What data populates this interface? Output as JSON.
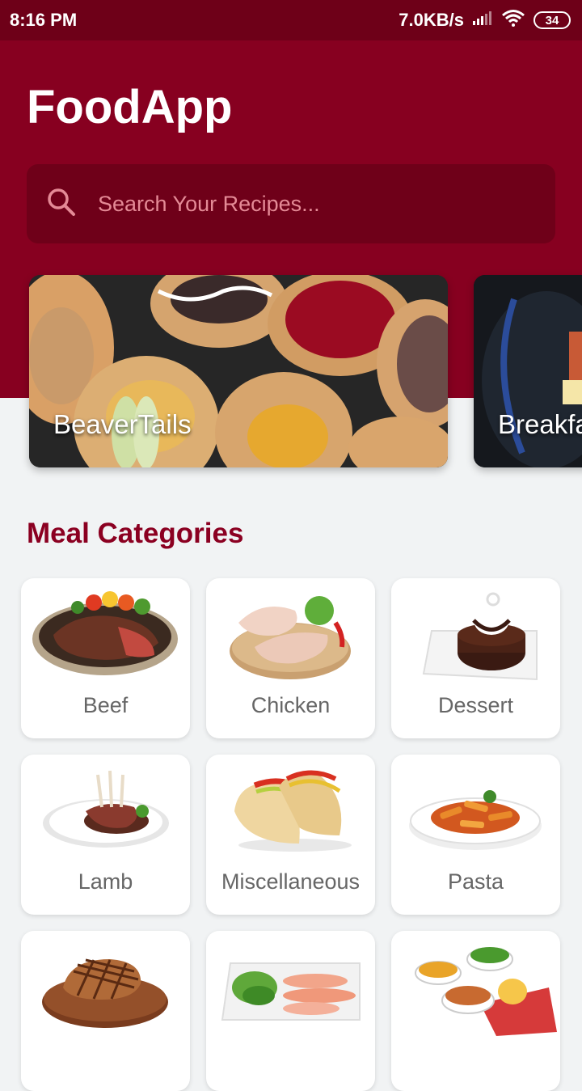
{
  "status_bar": {
    "time": "8:16 PM",
    "speed": "7.0KB/s",
    "battery": "34"
  },
  "app": {
    "title": "FoodApp"
  },
  "search": {
    "placeholder": "Search Your Recipes..."
  },
  "featured": [
    {
      "label": "BeaverTails"
    },
    {
      "label": "Breakfa"
    }
  ],
  "categories_title": "Meal Categories",
  "categories": [
    {
      "label": "Beef",
      "icon": "beef-icon"
    },
    {
      "label": "Chicken",
      "icon": "chicken-icon"
    },
    {
      "label": "Dessert",
      "icon": "dessert-icon"
    },
    {
      "label": "Lamb",
      "icon": "lamb-icon"
    },
    {
      "label": "Miscellaneous",
      "icon": "tacos-icon"
    },
    {
      "label": "Pasta",
      "icon": "pasta-icon"
    },
    {
      "label": "",
      "icon": "pork-icon"
    },
    {
      "label": "",
      "icon": "seafood-icon"
    },
    {
      "label": "",
      "icon": "side-dishes-icon"
    }
  ],
  "colors": {
    "header": "#870020",
    "status_bar": "#6e0018",
    "search_bg": "#6f0019",
    "accent_text": "#8b0021"
  }
}
